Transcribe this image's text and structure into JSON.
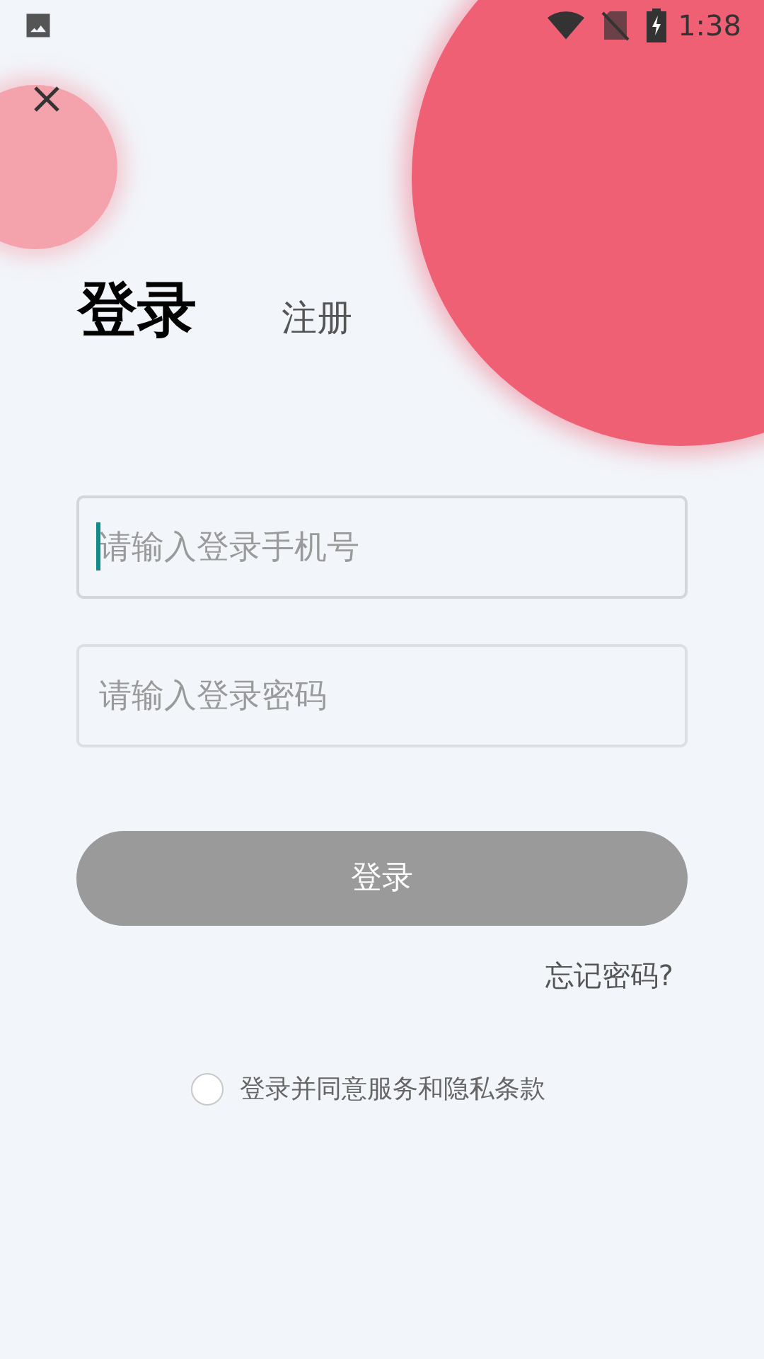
{
  "status_bar": {
    "time": "1:38"
  },
  "tabs": [
    {
      "label": "登录",
      "selected": true
    },
    {
      "label": "注册",
      "selected": false
    }
  ],
  "fields": [
    {
      "placeholder": "请输入登录手机号",
      "focused": true
    },
    {
      "placeholder": "请输入登录密码",
      "focused": false
    }
  ],
  "submit_button": {
    "label": "登录",
    "disabled": true
  },
  "forgot_link": "忘记密码?",
  "agreement": {
    "label": "登录并同意服务和隐私条款",
    "checked": false
  }
}
